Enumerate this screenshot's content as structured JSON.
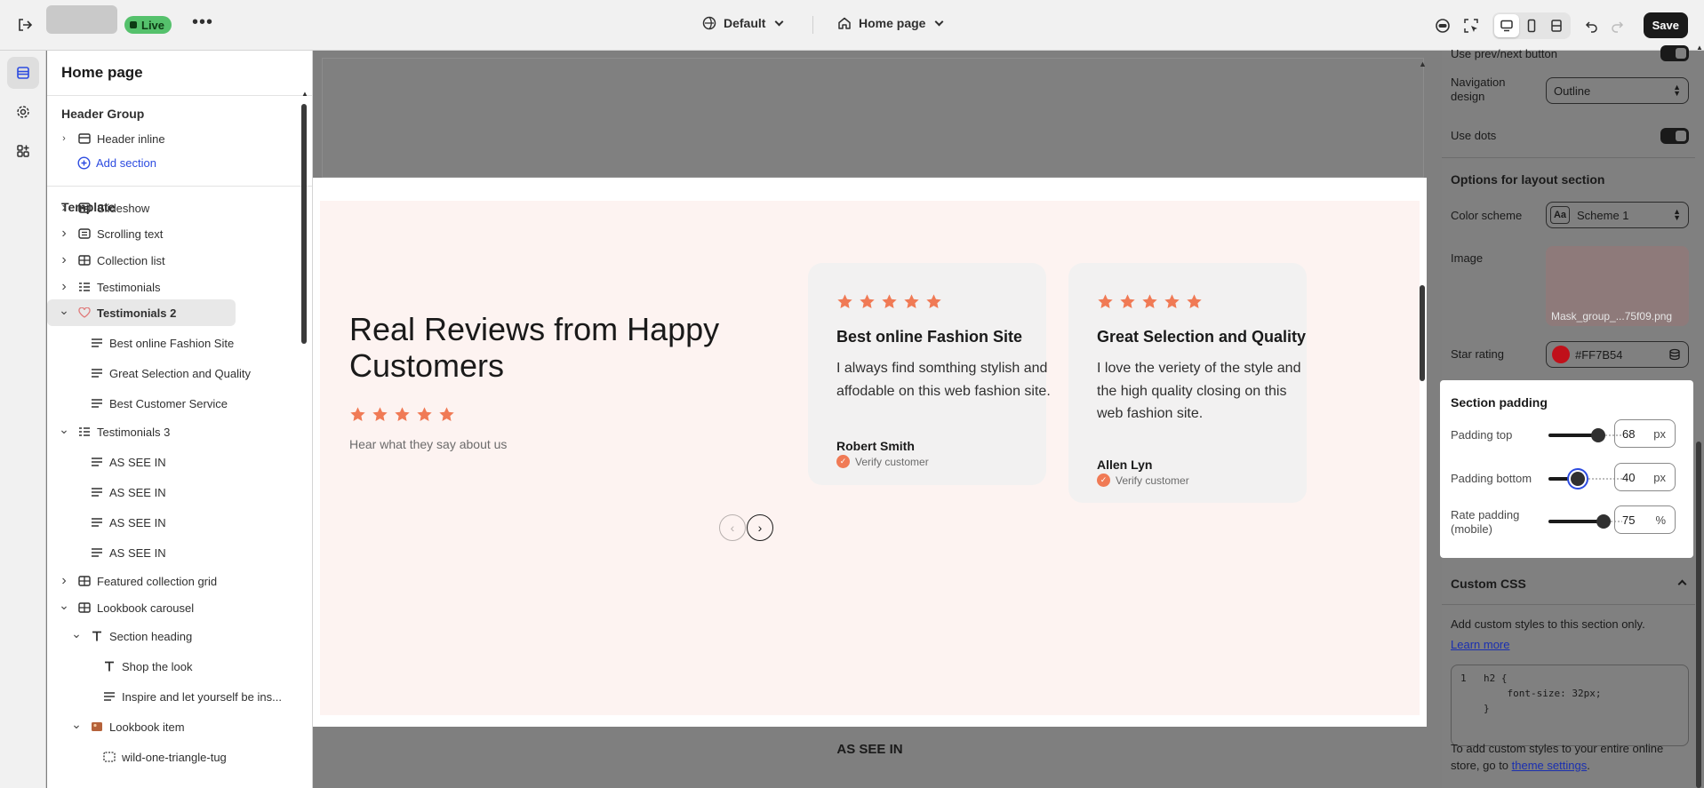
{
  "topbar": {
    "live_label": "Live",
    "theme_label": "Default",
    "page_label": "Home page",
    "save_label": "Save"
  },
  "sidebar": {
    "title": "Home page",
    "header_group_label": "Header Group",
    "header_items": [
      {
        "label": "Header inline"
      }
    ],
    "add_section_label": "Add section",
    "template_label": "Template",
    "items": [
      {
        "label": "Slideshow"
      },
      {
        "label": "Scrolling text"
      },
      {
        "label": "Collection list"
      },
      {
        "label": "Testimonials"
      },
      {
        "label": "Testimonials 2"
      },
      {
        "label": "Best online Fashion Site"
      },
      {
        "label": "Great Selection and Quality"
      },
      {
        "label": "Best Customer Service"
      },
      {
        "label": "Testimonials 3"
      },
      {
        "label": "AS SEE IN"
      },
      {
        "label": "AS SEE IN"
      },
      {
        "label": "AS SEE IN"
      },
      {
        "label": "AS SEE IN"
      },
      {
        "label": "Featured collection grid"
      },
      {
        "label": "Lookbook carousel"
      },
      {
        "label": "Section heading"
      },
      {
        "label": "Shop the look"
      },
      {
        "label": "Inspire and let yourself be ins..."
      },
      {
        "label": "Lookbook item"
      },
      {
        "label": "wild-one-triangle-tug"
      }
    ]
  },
  "preview": {
    "heading": "Real Reviews from Happy Customers",
    "subheading": "Hear what they say about us",
    "star_color": "#F07A55",
    "cards": [
      {
        "title": "Best online Fashion Site",
        "body": "I always find somthing stylish and affodable on this web fashion site.",
        "author": "Robert Smith",
        "verify": "Verify customer",
        "rating": 5
      },
      {
        "title": "Great Selection and Quality",
        "body": "I love the veriety of the style and the high quality closing on this web fashion site.",
        "author": "Allen Lyn",
        "verify": "Verify customer",
        "rating": 5
      }
    ],
    "next_section_label": "AS SEE IN"
  },
  "settings": {
    "prev_next_label": "Use prev/next button",
    "nav_design_label": "Navigation design",
    "nav_design_value": "Outline",
    "use_dots_label": "Use dots",
    "layout_options_heading": "Options for layout section",
    "color_scheme_label": "Color scheme",
    "color_scheme_value": "Scheme 1",
    "color_scheme_badge": "Aa",
    "image_label": "Image",
    "image_filename": "Mask_group_...75f09.png",
    "star_rating_label": "Star rating",
    "star_rating_value": "#FF7B54",
    "star_rating_color": "#C0101A",
    "section_padding": {
      "title": "Section padding",
      "rows": [
        {
          "label": "Padding top",
          "value": "68",
          "unit": "px",
          "fraction": 0.68
        },
        {
          "label": "Padding bottom",
          "value": "40",
          "unit": "px",
          "fraction": 0.4
        },
        {
          "label": "Rate padding (mobile)",
          "value": "75",
          "unit": "%",
          "fraction": 0.75
        }
      ]
    },
    "custom_css": {
      "title": "Custom CSS",
      "description": "Add custom styles to this section only.",
      "learn_more": "Learn more",
      "code_lines": [
        {
          "num": "1",
          "code": "h2 {"
        },
        {
          "num": "",
          "code": "    font-size: 32px;"
        },
        {
          "num": "",
          "code": "}"
        }
      ],
      "footer_prefix": "To add custom styles to your entire online store, go to ",
      "footer_link": "theme settings",
      "footer_suffix": "."
    }
  }
}
